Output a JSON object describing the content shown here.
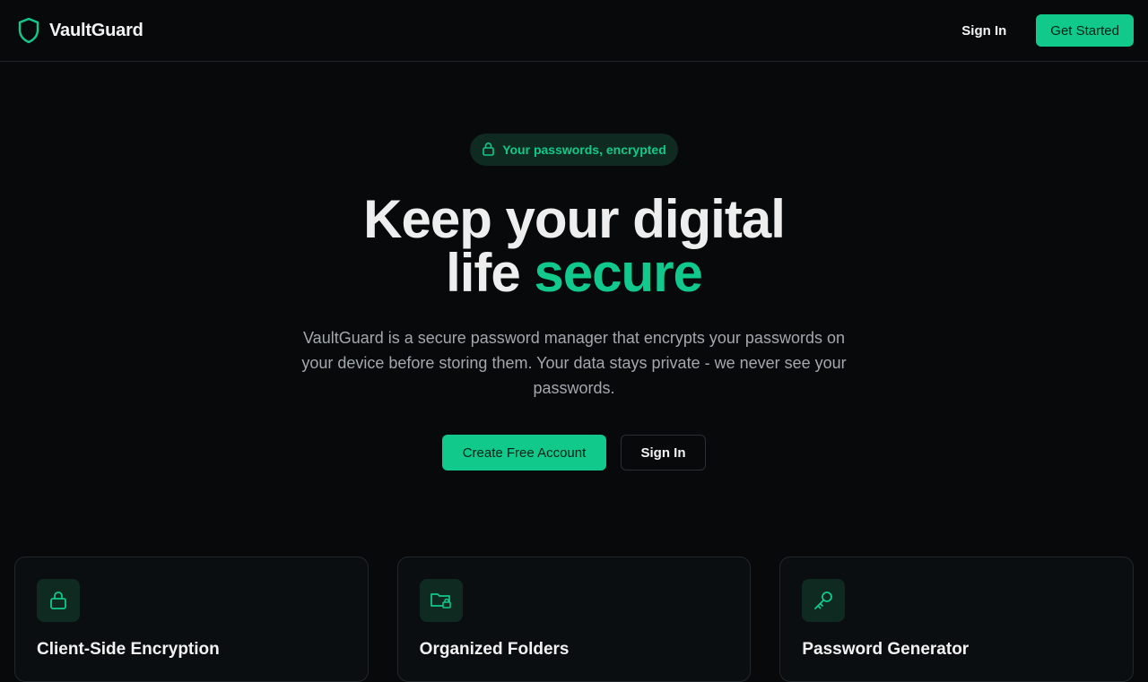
{
  "nav": {
    "brand": "VaultGuard",
    "sign_in": "Sign In",
    "get_started": "Get Started"
  },
  "hero": {
    "badge": "Your passwords, encrypted",
    "headline_line1": "Keep your digital",
    "headline_line2_plain": "life ",
    "headline_line2_accent": "secure",
    "subtitle": "VaultGuard is a secure password manager that encrypts your passwords on your device before storing them. Your data stays private - we never see your passwords.",
    "cta_primary": "Create Free Account",
    "cta_secondary": "Sign In"
  },
  "features": [
    {
      "icon": "lock-icon",
      "title": "Client-Side Encryption"
    },
    {
      "icon": "folder-lock-icon",
      "title": "Organized Folders"
    },
    {
      "icon": "key-icon",
      "title": "Password Generator"
    }
  ],
  "colors": {
    "accent": "#10c98a",
    "background": "#07090b"
  }
}
